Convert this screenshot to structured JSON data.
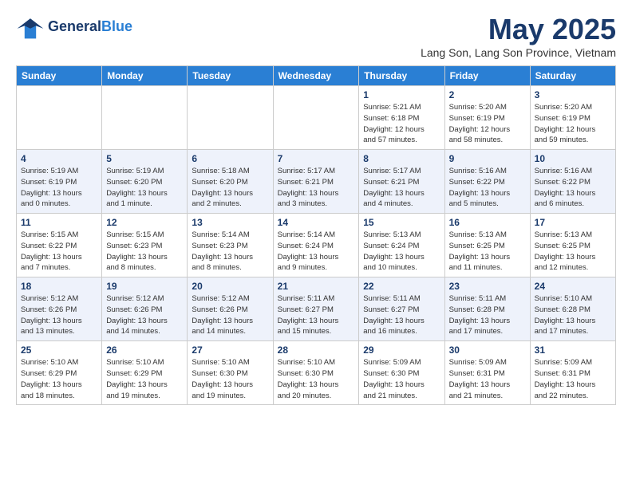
{
  "header": {
    "logo_line1": "General",
    "logo_line2": "Blue",
    "month": "May 2025",
    "location": "Lang Son, Lang Son Province, Vietnam"
  },
  "weekdays": [
    "Sunday",
    "Monday",
    "Tuesday",
    "Wednesday",
    "Thursday",
    "Friday",
    "Saturday"
  ],
  "weeks": [
    [
      {
        "day": "",
        "info": ""
      },
      {
        "day": "",
        "info": ""
      },
      {
        "day": "",
        "info": ""
      },
      {
        "day": "",
        "info": ""
      },
      {
        "day": "1",
        "info": "Sunrise: 5:21 AM\nSunset: 6:18 PM\nDaylight: 12 hours\nand 57 minutes."
      },
      {
        "day": "2",
        "info": "Sunrise: 5:20 AM\nSunset: 6:19 PM\nDaylight: 12 hours\nand 58 minutes."
      },
      {
        "day": "3",
        "info": "Sunrise: 5:20 AM\nSunset: 6:19 PM\nDaylight: 12 hours\nand 59 minutes."
      }
    ],
    [
      {
        "day": "4",
        "info": "Sunrise: 5:19 AM\nSunset: 6:19 PM\nDaylight: 13 hours\nand 0 minutes."
      },
      {
        "day": "5",
        "info": "Sunrise: 5:19 AM\nSunset: 6:20 PM\nDaylight: 13 hours\nand 1 minute."
      },
      {
        "day": "6",
        "info": "Sunrise: 5:18 AM\nSunset: 6:20 PM\nDaylight: 13 hours\nand 2 minutes."
      },
      {
        "day": "7",
        "info": "Sunrise: 5:17 AM\nSunset: 6:21 PM\nDaylight: 13 hours\nand 3 minutes."
      },
      {
        "day": "8",
        "info": "Sunrise: 5:17 AM\nSunset: 6:21 PM\nDaylight: 13 hours\nand 4 minutes."
      },
      {
        "day": "9",
        "info": "Sunrise: 5:16 AM\nSunset: 6:22 PM\nDaylight: 13 hours\nand 5 minutes."
      },
      {
        "day": "10",
        "info": "Sunrise: 5:16 AM\nSunset: 6:22 PM\nDaylight: 13 hours\nand 6 minutes."
      }
    ],
    [
      {
        "day": "11",
        "info": "Sunrise: 5:15 AM\nSunset: 6:22 PM\nDaylight: 13 hours\nand 7 minutes."
      },
      {
        "day": "12",
        "info": "Sunrise: 5:15 AM\nSunset: 6:23 PM\nDaylight: 13 hours\nand 8 minutes."
      },
      {
        "day": "13",
        "info": "Sunrise: 5:14 AM\nSunset: 6:23 PM\nDaylight: 13 hours\nand 8 minutes."
      },
      {
        "day": "14",
        "info": "Sunrise: 5:14 AM\nSunset: 6:24 PM\nDaylight: 13 hours\nand 9 minutes."
      },
      {
        "day": "15",
        "info": "Sunrise: 5:13 AM\nSunset: 6:24 PM\nDaylight: 13 hours\nand 10 minutes."
      },
      {
        "day": "16",
        "info": "Sunrise: 5:13 AM\nSunset: 6:25 PM\nDaylight: 13 hours\nand 11 minutes."
      },
      {
        "day": "17",
        "info": "Sunrise: 5:13 AM\nSunset: 6:25 PM\nDaylight: 13 hours\nand 12 minutes."
      }
    ],
    [
      {
        "day": "18",
        "info": "Sunrise: 5:12 AM\nSunset: 6:26 PM\nDaylight: 13 hours\nand 13 minutes."
      },
      {
        "day": "19",
        "info": "Sunrise: 5:12 AM\nSunset: 6:26 PM\nDaylight: 13 hours\nand 14 minutes."
      },
      {
        "day": "20",
        "info": "Sunrise: 5:12 AM\nSunset: 6:26 PM\nDaylight: 13 hours\nand 14 minutes."
      },
      {
        "day": "21",
        "info": "Sunrise: 5:11 AM\nSunset: 6:27 PM\nDaylight: 13 hours\nand 15 minutes."
      },
      {
        "day": "22",
        "info": "Sunrise: 5:11 AM\nSunset: 6:27 PM\nDaylight: 13 hours\nand 16 minutes."
      },
      {
        "day": "23",
        "info": "Sunrise: 5:11 AM\nSunset: 6:28 PM\nDaylight: 13 hours\nand 17 minutes."
      },
      {
        "day": "24",
        "info": "Sunrise: 5:10 AM\nSunset: 6:28 PM\nDaylight: 13 hours\nand 17 minutes."
      }
    ],
    [
      {
        "day": "25",
        "info": "Sunrise: 5:10 AM\nSunset: 6:29 PM\nDaylight: 13 hours\nand 18 minutes."
      },
      {
        "day": "26",
        "info": "Sunrise: 5:10 AM\nSunset: 6:29 PM\nDaylight: 13 hours\nand 19 minutes."
      },
      {
        "day": "27",
        "info": "Sunrise: 5:10 AM\nSunset: 6:30 PM\nDaylight: 13 hours\nand 19 minutes."
      },
      {
        "day": "28",
        "info": "Sunrise: 5:10 AM\nSunset: 6:30 PM\nDaylight: 13 hours\nand 20 minutes."
      },
      {
        "day": "29",
        "info": "Sunrise: 5:09 AM\nSunset: 6:30 PM\nDaylight: 13 hours\nand 21 minutes."
      },
      {
        "day": "30",
        "info": "Sunrise: 5:09 AM\nSunset: 6:31 PM\nDaylight: 13 hours\nand 21 minutes."
      },
      {
        "day": "31",
        "info": "Sunrise: 5:09 AM\nSunset: 6:31 PM\nDaylight: 13 hours\nand 22 minutes."
      }
    ]
  ]
}
